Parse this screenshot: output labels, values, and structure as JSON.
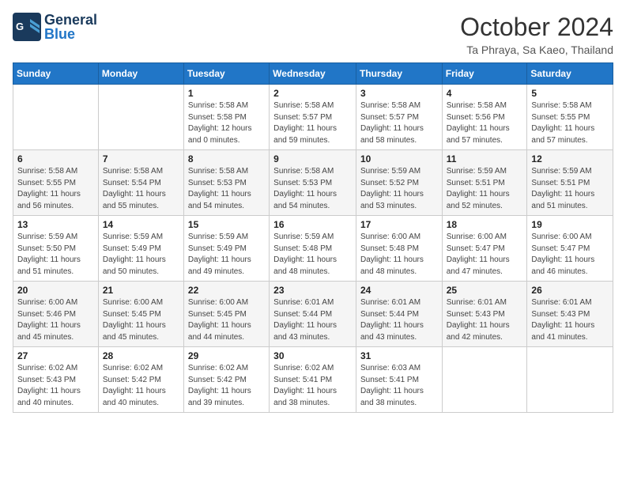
{
  "logo": {
    "text_general": "General",
    "text_blue": "Blue"
  },
  "title": "October 2024",
  "location": "Ta Phraya, Sa Kaeo, Thailand",
  "weekdays": [
    "Sunday",
    "Monday",
    "Tuesday",
    "Wednesday",
    "Thursday",
    "Friday",
    "Saturday"
  ],
  "weeks": [
    [
      {
        "day": "",
        "info": ""
      },
      {
        "day": "",
        "info": ""
      },
      {
        "day": "1",
        "info": "Sunrise: 5:58 AM\nSunset: 5:58 PM\nDaylight: 12 hours\nand 0 minutes."
      },
      {
        "day": "2",
        "info": "Sunrise: 5:58 AM\nSunset: 5:57 PM\nDaylight: 11 hours\nand 59 minutes."
      },
      {
        "day": "3",
        "info": "Sunrise: 5:58 AM\nSunset: 5:57 PM\nDaylight: 11 hours\nand 58 minutes."
      },
      {
        "day": "4",
        "info": "Sunrise: 5:58 AM\nSunset: 5:56 PM\nDaylight: 11 hours\nand 57 minutes."
      },
      {
        "day": "5",
        "info": "Sunrise: 5:58 AM\nSunset: 5:55 PM\nDaylight: 11 hours\nand 57 minutes."
      }
    ],
    [
      {
        "day": "6",
        "info": "Sunrise: 5:58 AM\nSunset: 5:55 PM\nDaylight: 11 hours\nand 56 minutes."
      },
      {
        "day": "7",
        "info": "Sunrise: 5:58 AM\nSunset: 5:54 PM\nDaylight: 11 hours\nand 55 minutes."
      },
      {
        "day": "8",
        "info": "Sunrise: 5:58 AM\nSunset: 5:53 PM\nDaylight: 11 hours\nand 54 minutes."
      },
      {
        "day": "9",
        "info": "Sunrise: 5:58 AM\nSunset: 5:53 PM\nDaylight: 11 hours\nand 54 minutes."
      },
      {
        "day": "10",
        "info": "Sunrise: 5:59 AM\nSunset: 5:52 PM\nDaylight: 11 hours\nand 53 minutes."
      },
      {
        "day": "11",
        "info": "Sunrise: 5:59 AM\nSunset: 5:51 PM\nDaylight: 11 hours\nand 52 minutes."
      },
      {
        "day": "12",
        "info": "Sunrise: 5:59 AM\nSunset: 5:51 PM\nDaylight: 11 hours\nand 51 minutes."
      }
    ],
    [
      {
        "day": "13",
        "info": "Sunrise: 5:59 AM\nSunset: 5:50 PM\nDaylight: 11 hours\nand 51 minutes."
      },
      {
        "day": "14",
        "info": "Sunrise: 5:59 AM\nSunset: 5:49 PM\nDaylight: 11 hours\nand 50 minutes."
      },
      {
        "day": "15",
        "info": "Sunrise: 5:59 AM\nSunset: 5:49 PM\nDaylight: 11 hours\nand 49 minutes."
      },
      {
        "day": "16",
        "info": "Sunrise: 5:59 AM\nSunset: 5:48 PM\nDaylight: 11 hours\nand 48 minutes."
      },
      {
        "day": "17",
        "info": "Sunrise: 6:00 AM\nSunset: 5:48 PM\nDaylight: 11 hours\nand 48 minutes."
      },
      {
        "day": "18",
        "info": "Sunrise: 6:00 AM\nSunset: 5:47 PM\nDaylight: 11 hours\nand 47 minutes."
      },
      {
        "day": "19",
        "info": "Sunrise: 6:00 AM\nSunset: 5:47 PM\nDaylight: 11 hours\nand 46 minutes."
      }
    ],
    [
      {
        "day": "20",
        "info": "Sunrise: 6:00 AM\nSunset: 5:46 PM\nDaylight: 11 hours\nand 45 minutes."
      },
      {
        "day": "21",
        "info": "Sunrise: 6:00 AM\nSunset: 5:45 PM\nDaylight: 11 hours\nand 45 minutes."
      },
      {
        "day": "22",
        "info": "Sunrise: 6:00 AM\nSunset: 5:45 PM\nDaylight: 11 hours\nand 44 minutes."
      },
      {
        "day": "23",
        "info": "Sunrise: 6:01 AM\nSunset: 5:44 PM\nDaylight: 11 hours\nand 43 minutes."
      },
      {
        "day": "24",
        "info": "Sunrise: 6:01 AM\nSunset: 5:44 PM\nDaylight: 11 hours\nand 43 minutes."
      },
      {
        "day": "25",
        "info": "Sunrise: 6:01 AM\nSunset: 5:43 PM\nDaylight: 11 hours\nand 42 minutes."
      },
      {
        "day": "26",
        "info": "Sunrise: 6:01 AM\nSunset: 5:43 PM\nDaylight: 11 hours\nand 41 minutes."
      }
    ],
    [
      {
        "day": "27",
        "info": "Sunrise: 6:02 AM\nSunset: 5:43 PM\nDaylight: 11 hours\nand 40 minutes."
      },
      {
        "day": "28",
        "info": "Sunrise: 6:02 AM\nSunset: 5:42 PM\nDaylight: 11 hours\nand 40 minutes."
      },
      {
        "day": "29",
        "info": "Sunrise: 6:02 AM\nSunset: 5:42 PM\nDaylight: 11 hours\nand 39 minutes."
      },
      {
        "day": "30",
        "info": "Sunrise: 6:02 AM\nSunset: 5:41 PM\nDaylight: 11 hours\nand 38 minutes."
      },
      {
        "day": "31",
        "info": "Sunrise: 6:03 AM\nSunset: 5:41 PM\nDaylight: 11 hours\nand 38 minutes."
      },
      {
        "day": "",
        "info": ""
      },
      {
        "day": "",
        "info": ""
      }
    ]
  ]
}
